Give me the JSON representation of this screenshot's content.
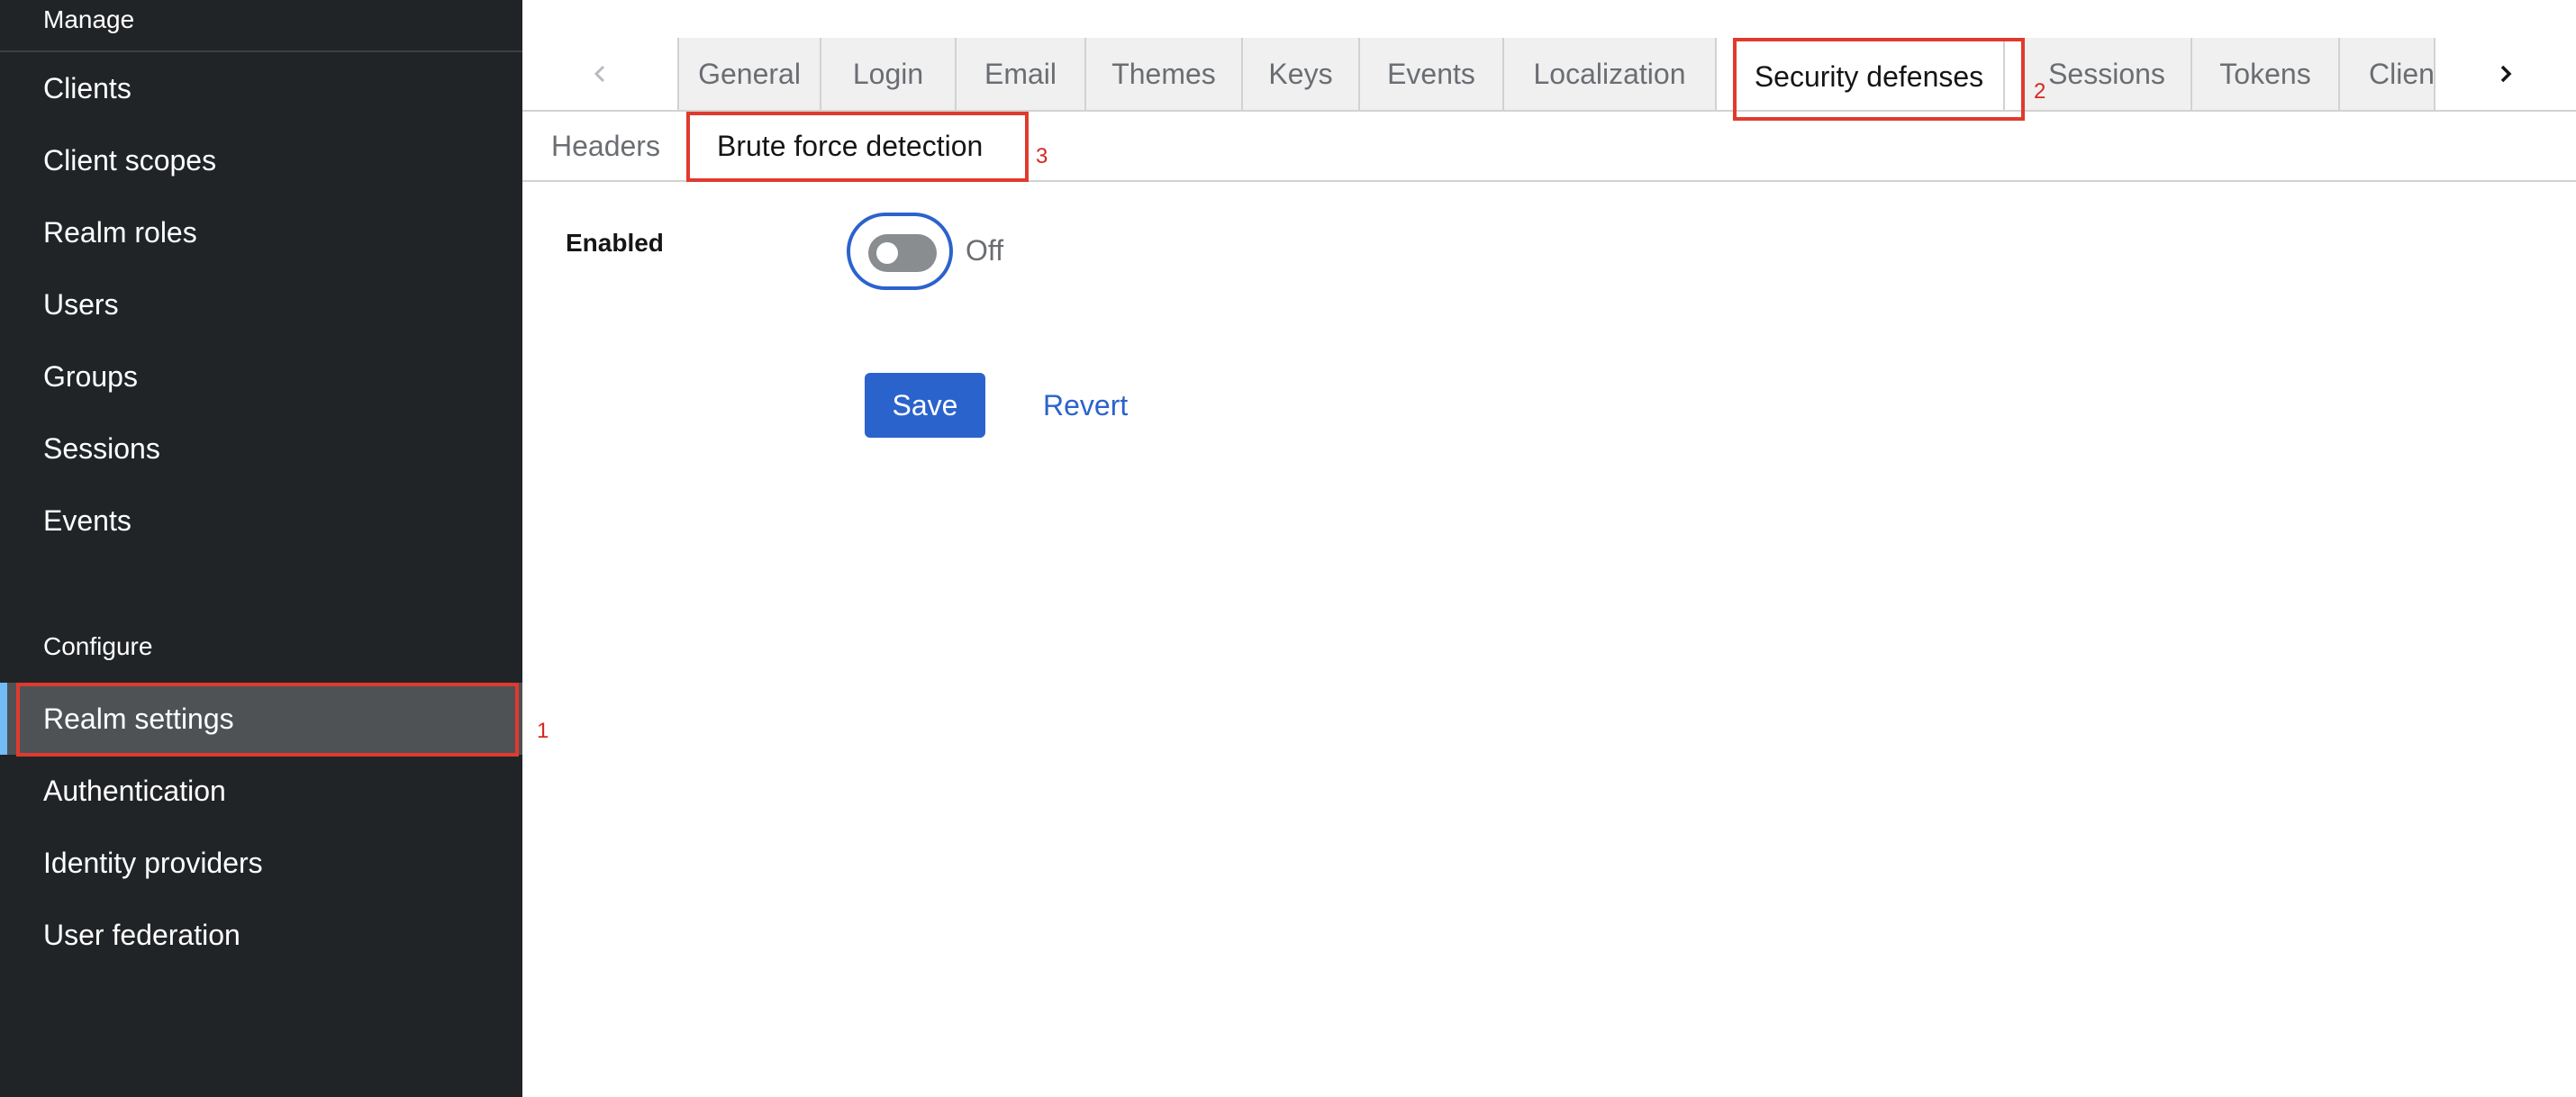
{
  "sidebar": {
    "manage_header": "Manage",
    "manage_items": [
      {
        "label": "Clients"
      },
      {
        "label": "Client scopes"
      },
      {
        "label": "Realm roles"
      },
      {
        "label": "Users"
      },
      {
        "label": "Groups"
      },
      {
        "label": "Sessions"
      },
      {
        "label": "Events"
      }
    ],
    "configure_header": "Configure",
    "configure_items": [
      {
        "label": "Realm settings",
        "active": true
      },
      {
        "label": "Authentication"
      },
      {
        "label": "Identity providers"
      },
      {
        "label": "User federation"
      }
    ]
  },
  "tabs": {
    "items": [
      {
        "label": "General"
      },
      {
        "label": "Login"
      },
      {
        "label": "Email"
      },
      {
        "label": "Themes"
      },
      {
        "label": "Keys"
      },
      {
        "label": "Events"
      },
      {
        "label": "Localization"
      },
      {
        "label": "Security defenses",
        "active": true
      },
      {
        "label": "Sessions"
      },
      {
        "label": "Tokens"
      },
      {
        "label": "Clien"
      }
    ]
  },
  "subtabs": {
    "items": [
      {
        "label": "Headers"
      },
      {
        "label": "Brute force detection",
        "active": true
      }
    ]
  },
  "form": {
    "enabled_label": "Enabled",
    "toggle_state": "Off",
    "save_label": "Save",
    "revert_label": "Revert"
  },
  "annotations": {
    "marker_1": "1",
    "marker_2": "2",
    "marker_3": "3"
  },
  "colors": {
    "sidebar_bg": "#212427",
    "sidebar_active_bg": "#4f5255",
    "sidebar_active_accent": "#73bcf7",
    "primary": "#2b63cc",
    "highlight_red": "#e03a2e",
    "tab_inactive_bg": "#f0f0f0"
  },
  "icons": {
    "scroll_left": "chevron-left-icon",
    "scroll_right": "chevron-right-icon"
  }
}
